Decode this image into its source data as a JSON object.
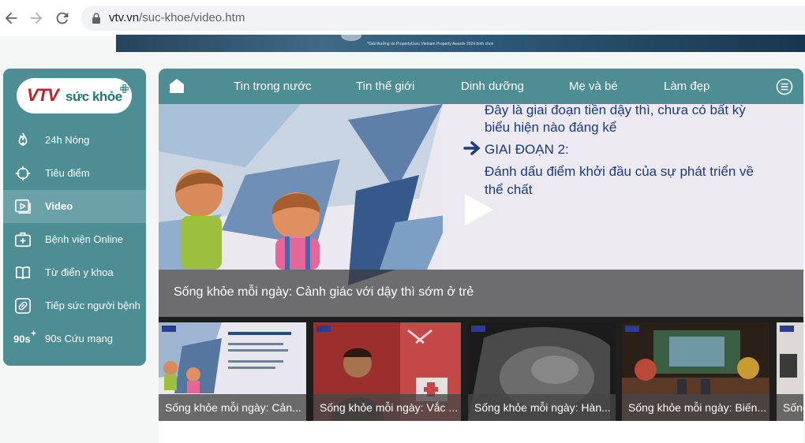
{
  "browser": {
    "url_domain": "vtv.vn",
    "url_path": "/suc-khoe/video.htm"
  },
  "banner": {
    "caption": "*Giải thưởng do PropertyGuru Vietnam Property Awards 2024 bình chọn"
  },
  "logo": {
    "vtv": "VTV",
    "name": "sức khỏe"
  },
  "sidebar": {
    "items": [
      {
        "icon": "fire-icon",
        "label": "24h Nóng"
      },
      {
        "icon": "target-icon",
        "label": "Tiêu điểm"
      },
      {
        "icon": "video-icon",
        "label": "Video",
        "active": true
      },
      {
        "icon": "hospital-icon",
        "label": "Bệnh viện Online"
      },
      {
        "icon": "book-icon",
        "label": "Từ điển y khoa"
      },
      {
        "icon": "pills-icon",
        "label": "Tiếp sức người bệnh"
      },
      {
        "icon": "90s-badge-icon",
        "label": "90s Cứu mạng",
        "badge": "90s"
      }
    ]
  },
  "topnav": {
    "items": [
      "Tin trong nước",
      "Tin thế giới",
      "Dinh dưỡng",
      "Mẹ và bé",
      "Làm đẹp"
    ]
  },
  "hero": {
    "slide_line1": "Đây là giai đoạn tiền dậy thì, chưa có bất kỳ",
    "slide_line2": "biểu hiện nào đáng kể",
    "slide_heading": "GIAI ĐOẠN 2:",
    "slide_line3": "Đánh dấu điểm khởi đầu của sự phát triển về",
    "slide_line4": "thể chất",
    "title": "Sống khỏe mỗi ngày: Cảnh giác với dậy thì sớm ở trẻ"
  },
  "thumbnails": [
    {
      "label": "Sống khỏe mỗi ngày: Cản..."
    },
    {
      "label": "Sống khỏe mỗi ngày: Vắc ..."
    },
    {
      "label": "Sống khỏe mỗi ngày: Hàn..."
    },
    {
      "label": "Sống khỏe mỗi ngày: Biến..."
    },
    {
      "label": "Sống"
    }
  ]
}
